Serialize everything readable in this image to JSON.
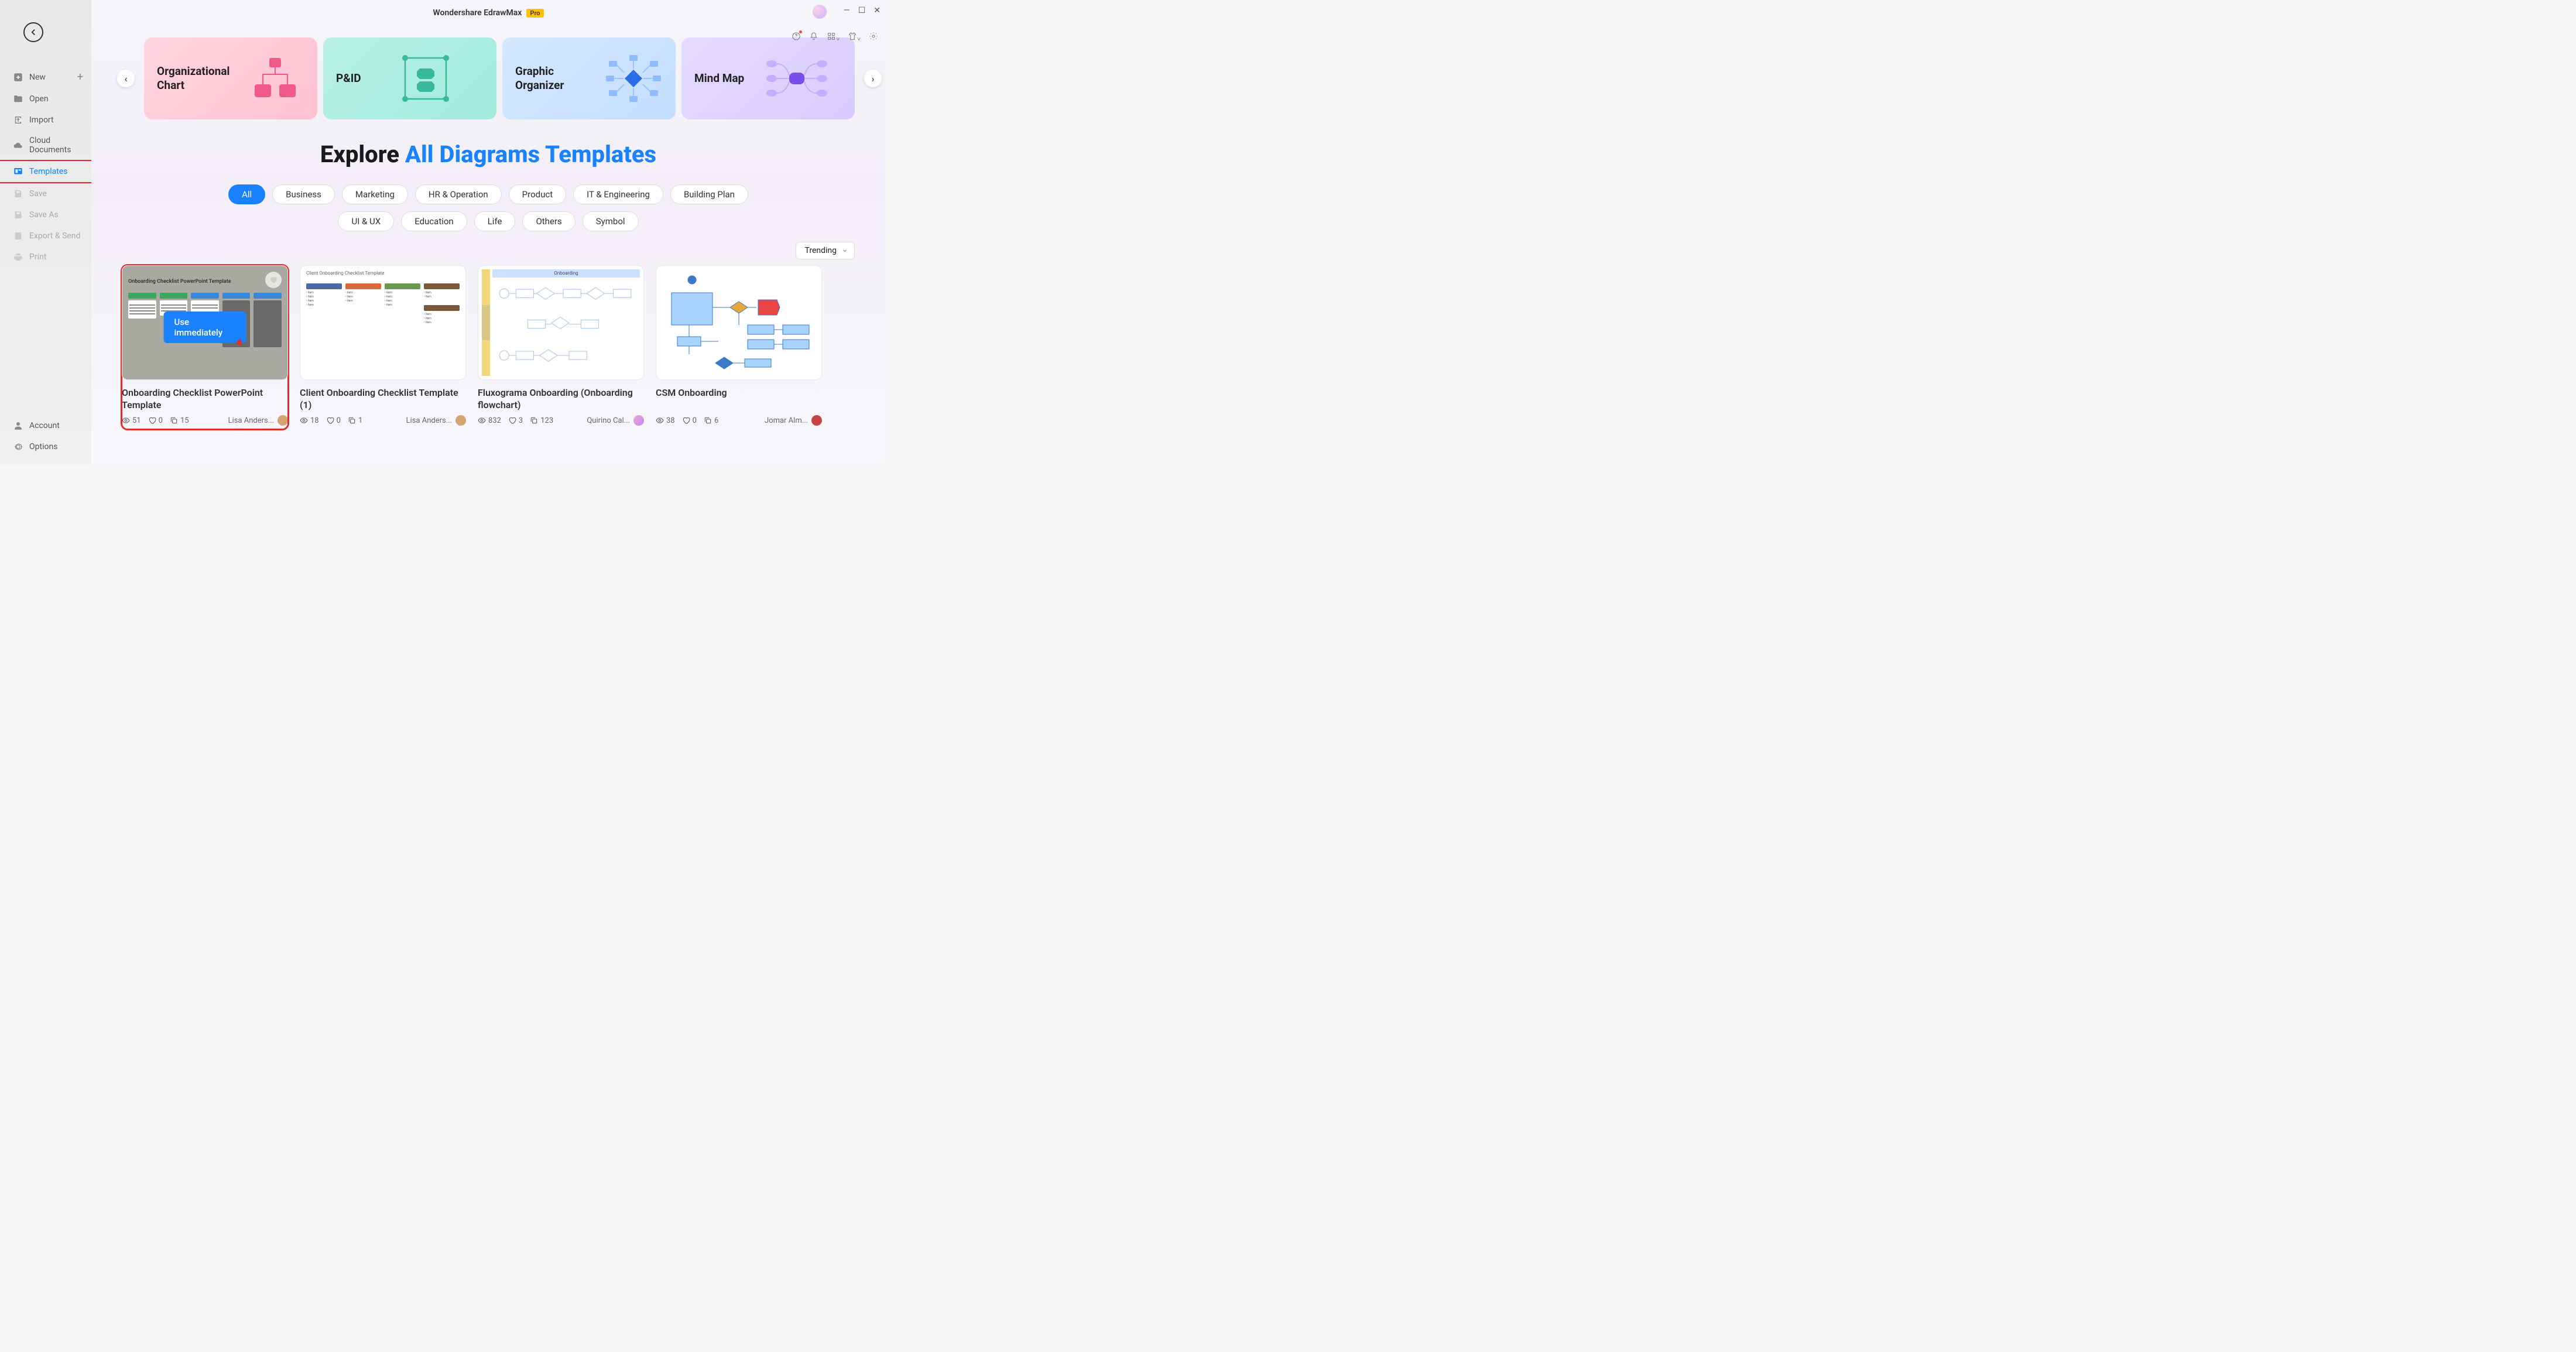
{
  "app": {
    "title": "Wondershare EdrawMax",
    "badge": "Pro"
  },
  "sidebar": {
    "back": "Back",
    "items": [
      {
        "label": "New",
        "icon": "plus-square",
        "showPlus": true
      },
      {
        "label": "Open",
        "icon": "folder"
      },
      {
        "label": "Import",
        "icon": "import"
      },
      {
        "label": "Cloud Documents",
        "icon": "cloud"
      },
      {
        "label": "Templates",
        "icon": "template",
        "active": true,
        "highlighted": true
      },
      {
        "label": "Save",
        "icon": "save",
        "disabled": true
      },
      {
        "label": "Save As",
        "icon": "save-as",
        "disabled": true
      },
      {
        "label": "Export & Send",
        "icon": "export",
        "disabled": true
      },
      {
        "label": "Print",
        "icon": "print",
        "disabled": true
      }
    ],
    "bottom": [
      {
        "label": "Account",
        "icon": "account"
      },
      {
        "label": "Options",
        "icon": "gear"
      }
    ]
  },
  "categories": [
    {
      "label": "Organizational Chart",
      "color": "c1"
    },
    {
      "label": "P&ID",
      "color": "c2"
    },
    {
      "label": "Graphic Organizer",
      "color": "c3"
    },
    {
      "label": "Mind Map",
      "color": "c4"
    }
  ],
  "explore": {
    "prefix": "Explore ",
    "highlight": "All Diagrams Templates"
  },
  "filters": {
    "row1": [
      {
        "label": "All",
        "active": true
      },
      {
        "label": "Business"
      },
      {
        "label": "Marketing"
      },
      {
        "label": "HR & Operation"
      },
      {
        "label": "Product"
      },
      {
        "label": "IT & Engineering"
      },
      {
        "label": "Building Plan"
      }
    ],
    "row2": [
      {
        "label": "UI & UX"
      },
      {
        "label": "Education"
      },
      {
        "label": "Life"
      },
      {
        "label": "Others"
      },
      {
        "label": "Symbol"
      }
    ]
  },
  "sort": {
    "selected": "Trending"
  },
  "templates": [
    {
      "title": "Onboarding Checklist PowerPoint Template",
      "views": "51",
      "likes": "0",
      "copies": "15",
      "author": "Lisa Anders...",
      "avatarColor": "#d4a574",
      "hovered": true,
      "useLabel": "Use immediately",
      "highlighted": true
    },
    {
      "title": "Client Onboarding Checklist Template (1)",
      "views": "18",
      "likes": "0",
      "copies": "1",
      "author": "Lisa Anders...",
      "avatarColor": "#d4a574"
    },
    {
      "title": "Fluxograma Onboarding (Onboarding flowchart)",
      "views": "832",
      "likes": "3",
      "copies": "123",
      "author": "Quirino Cal...",
      "avatarColor": "#e8a8d8"
    },
    {
      "title": "CSM Onboarding",
      "views": "38",
      "likes": "0",
      "copies": "6",
      "author": "Jomar Alm...",
      "avatarColor": "#c84444"
    }
  ]
}
